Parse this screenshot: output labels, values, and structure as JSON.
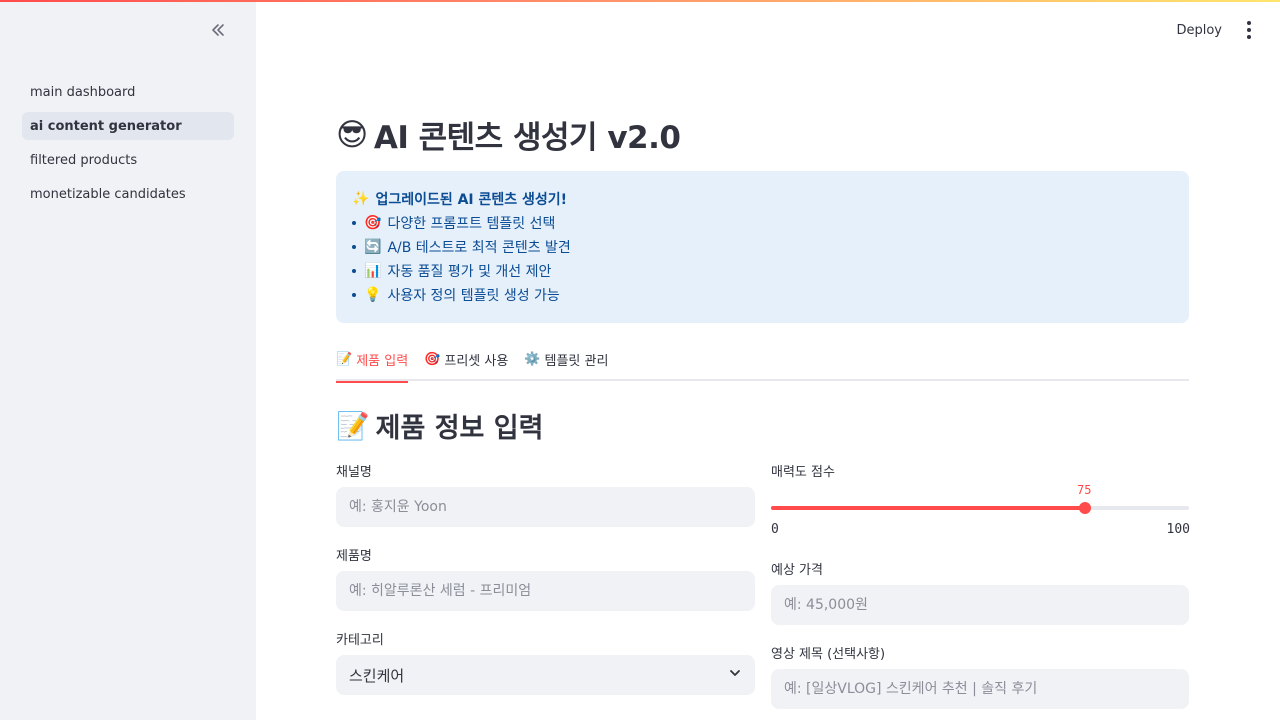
{
  "app": {
    "accent_color": "#ff4b4b",
    "deploy_label": "Deploy"
  },
  "sidebar": {
    "collapse_icon": "double-chevron-left-icon",
    "items": [
      {
        "label": "main dashboard",
        "active": false
      },
      {
        "label": "ai content generator",
        "active": true
      },
      {
        "label": "filtered products",
        "active": false
      },
      {
        "label": "monetizable candidates",
        "active": false
      }
    ]
  },
  "main": {
    "title_emoji": "😎",
    "title": "AI 콘텐츠 생성기 v2.0",
    "info": {
      "headline_emoji": "✨",
      "headline": "업그레이드된 AI 콘텐츠 생성기!",
      "bullets": [
        {
          "emoji": "🎯",
          "text": "다양한 프롬프트 템플릿 선택"
        },
        {
          "emoji": "🔄",
          "text": "A/B 테스트로 최적 콘텐츠 발견"
        },
        {
          "emoji": "📊",
          "text": "자동 품질 평가 및 개선 제안"
        },
        {
          "emoji": "💡",
          "text": "사용자 정의 템플릿 생성 가능"
        }
      ]
    },
    "tabs": [
      {
        "emoji": "📝",
        "label": "제품 입력",
        "active": true
      },
      {
        "emoji": "🎯",
        "label": "프리셋 사용",
        "active": false
      },
      {
        "emoji": "⚙️",
        "label": "템플릿 관리",
        "active": false
      }
    ],
    "section": {
      "emoji": "📝",
      "title": "제품 정보 입력"
    },
    "form": {
      "channel": {
        "label": "채널명",
        "placeholder": "예: 홍지윤 Yoon",
        "value": ""
      },
      "product": {
        "label": "제품명",
        "placeholder": "예: 히알루론산 세럼 - 프리미엄",
        "value": ""
      },
      "category": {
        "label": "카테고리",
        "value": "스킨케어"
      },
      "appeal": {
        "label": "매력도 점수",
        "value": 75,
        "min": 0,
        "max": 100,
        "value_text": "75",
        "min_text": "0",
        "max_text": "100"
      },
      "price": {
        "label": "예상 가격",
        "placeholder": "예: 45,000원",
        "value": ""
      },
      "video_title": {
        "label": "영상 제목 (선택사항)",
        "placeholder": "예: [일상VLOG] 스킨케어 추천 | 솔직 후기",
        "value": ""
      }
    }
  }
}
